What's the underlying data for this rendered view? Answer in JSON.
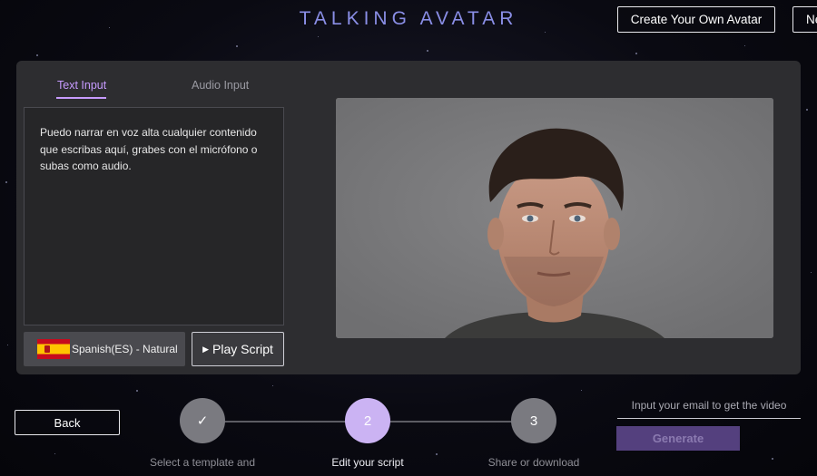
{
  "header": {
    "title": "TALKING AVATAR",
    "create_avatar_label": "Create Your Own Avatar",
    "next_label": "Ne"
  },
  "editor": {
    "tabs": [
      {
        "label": "Text Input",
        "active": true
      },
      {
        "label": "Audio Input",
        "active": false
      }
    ],
    "script_text": "Puedo narrar en voz alta cualquier contenido que escribas aquí, grabes con el micrófono o subas como audio.",
    "voice_label": "Spanish(ES) - Natural",
    "play_label": "Play Script"
  },
  "steps": {
    "back_label": "Back",
    "items": [
      {
        "number": "✓",
        "label": "Select a template and",
        "state": "done"
      },
      {
        "number": "2",
        "label": "Edit your script",
        "state": "active"
      },
      {
        "number": "3",
        "label": "Share or download",
        "state": "pending"
      }
    ]
  },
  "delivery": {
    "email_placeholder": "Input your email to get the video",
    "generate_label": "Generate"
  },
  "colors": {
    "accent": "#c79bff",
    "active_step": "#cbb3f3",
    "generate_bg": "#54407e",
    "panel_bg": "#2d2d30"
  },
  "icons": {
    "flag": "spain-flag-icon",
    "play": "play-icon",
    "check": "check-icon"
  }
}
